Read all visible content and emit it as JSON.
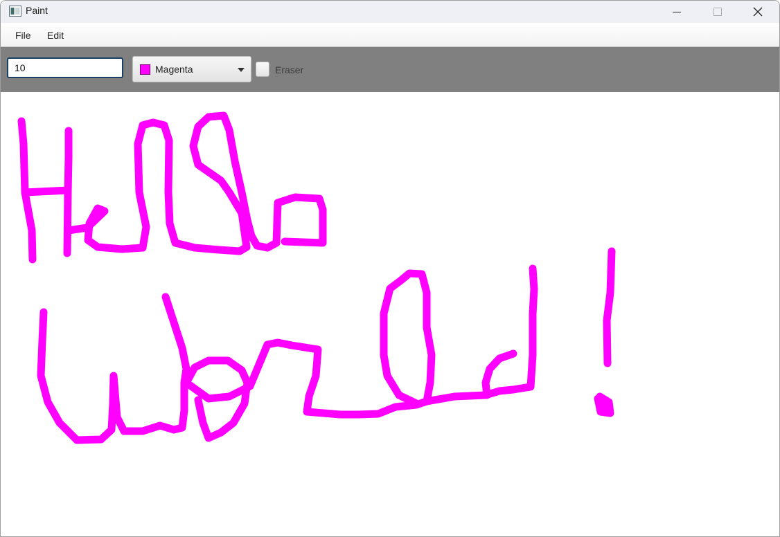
{
  "window": {
    "title": "Paint",
    "icon": "app-window-icon",
    "controls": [
      "minimize-icon",
      "maximize-icon",
      "close-icon"
    ]
  },
  "menu": {
    "items": [
      {
        "label": "File"
      },
      {
        "label": "Edit"
      }
    ]
  },
  "toolbar": {
    "brush_size_value": "10",
    "color_picker": {
      "selected": "Magenta",
      "swatch_color": "#ff00ff"
    },
    "eraser": {
      "label": "Eraser",
      "checked": false
    }
  },
  "canvas": {
    "background": "#ffffff",
    "stroke_color": "#ff00ff",
    "drawn_text": "Hello World!"
  }
}
